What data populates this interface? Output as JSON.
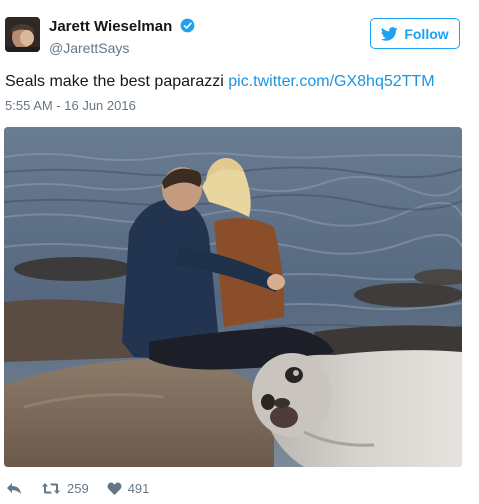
{
  "author": {
    "display_name": "Jarett Wieselman",
    "handle": "@JarettSays",
    "verified": true
  },
  "follow_button": {
    "label": "Follow"
  },
  "tweet": {
    "text": "Seals make the best paparazzi ",
    "link_text": "pic.twitter.com/GX8hq52TTM",
    "timestamp": "5:55 AM - 16 Jun 2016"
  },
  "actions": {
    "retweet_count": "259",
    "like_count": "491"
  },
  "icons": {
    "verified": "verified-badge-icon",
    "follow": "twitter-bird-icon",
    "reply": "reply-icon",
    "retweet": "retweet-icon",
    "like": "heart-icon"
  },
  "colors": {
    "accent": "#1da1f2",
    "link": "#1b95e0",
    "muted": "#657786",
    "text": "#14171a"
  }
}
